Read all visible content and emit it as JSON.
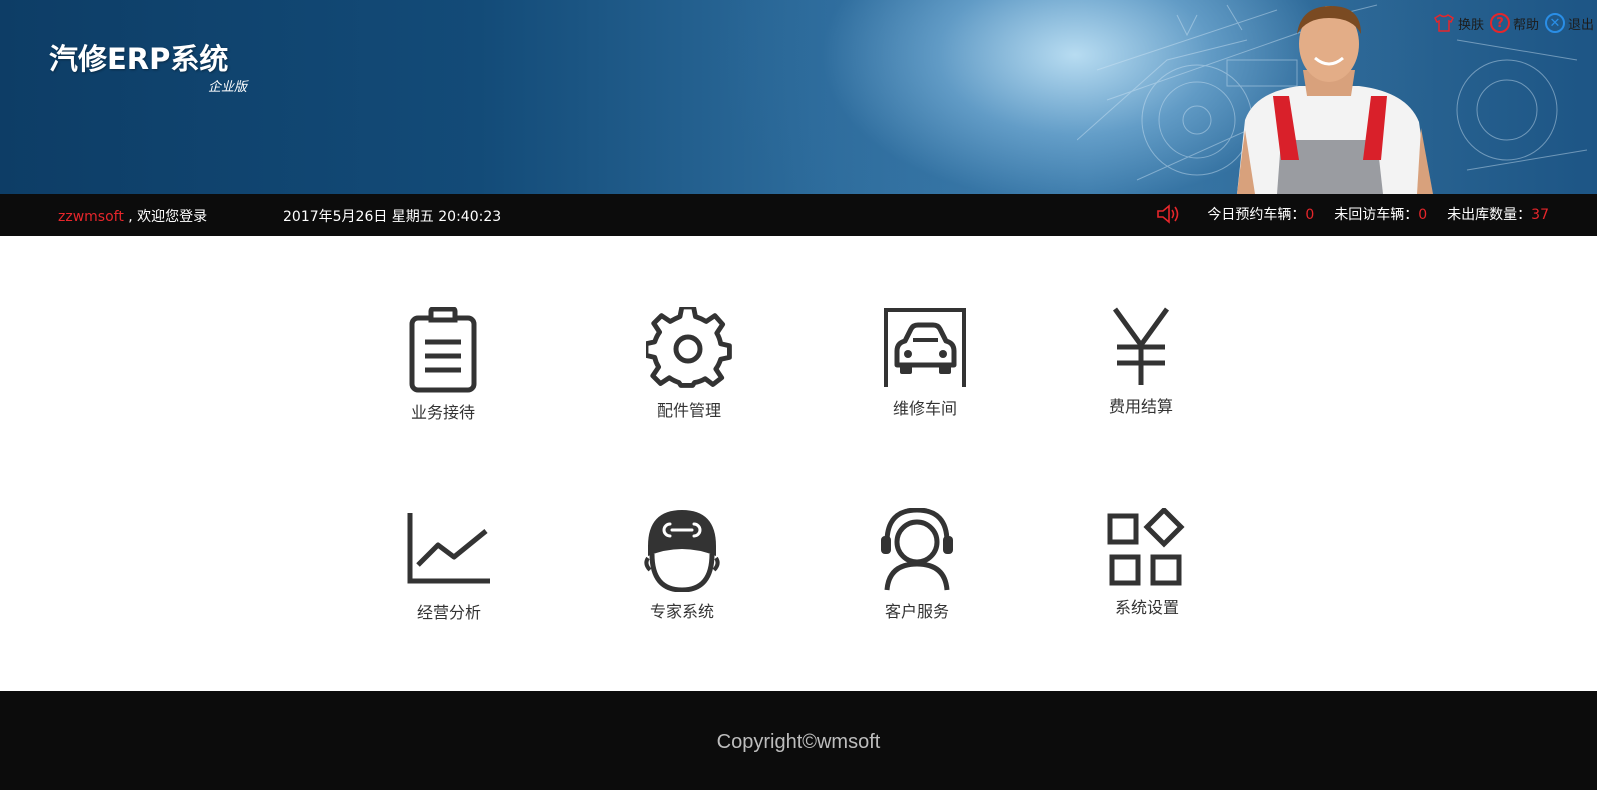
{
  "header": {
    "logo_title": "汽修ERP系统",
    "logo_subtitle": "企业版",
    "actions": [
      {
        "label": "换肤",
        "icon": "shirt-icon",
        "color": "#e6262b"
      },
      {
        "label": "帮助",
        "icon": "help-icon",
        "color": "#e6262b"
      },
      {
        "label": "退出",
        "icon": "close-icon",
        "color": "#2a8ee6"
      }
    ]
  },
  "infobar": {
    "username": "zzwmsoft",
    "welcome": " , 欢迎您登录",
    "datetime": "2017年5月26日 星期五 20:40:23",
    "stats": [
      {
        "label": "今日预约车辆：",
        "value": "0"
      },
      {
        "label": "未回访车辆：",
        "value": "0"
      },
      {
        "label": "未出库数量：",
        "value": "37"
      }
    ]
  },
  "menu": [
    {
      "label": "业务接待",
      "icon": "clipboard-icon"
    },
    {
      "label": "配件管理",
      "icon": "gear-icon"
    },
    {
      "label": "维修车间",
      "icon": "garage-car-icon"
    },
    {
      "label": "费用结算",
      "icon": "yen-icon"
    },
    {
      "label": "经营分析",
      "icon": "line-chart-icon"
    },
    {
      "label": "专家系统",
      "icon": "mechanic-icon"
    },
    {
      "label": "客户服务",
      "icon": "headset-user-icon"
    },
    {
      "label": "系统设置",
      "icon": "apps-settings-icon"
    }
  ],
  "footer": {
    "copyright": "Copyright©wmsoft"
  },
  "colors": {
    "accent_red": "#e6262b",
    "bar_bg": "#0c0c0c",
    "banner_blue": "#134b78",
    "icon_gray": "#333333"
  }
}
